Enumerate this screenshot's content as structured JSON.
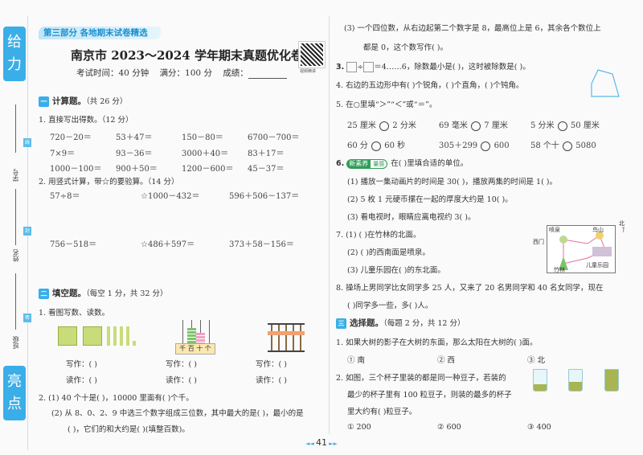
{
  "side": {
    "top_tab": "给力",
    "bottom_tab": "亮点",
    "student_id": "学号",
    "name": "姓名",
    "class": "班级",
    "marks": [
      "线",
      "封",
      "密"
    ]
  },
  "banner": "第三部分  各地期末试卷精选",
  "title": "南京市 2023～2024 学年期末真题优化卷(一)",
  "exam_info": {
    "time": "考试时间：40 分钟",
    "full": "满分：100 分",
    "score": "成绩："
  },
  "qr_label": "视频精讲",
  "section1": {
    "badge": "一",
    "title": "计算题。",
    "points": "（共 26 分）",
    "q1": {
      "label": "1. 直接写出得数。（12 分）",
      "items": [
        "720－20＝",
        "53＋47＝",
        "150－80＝",
        "6700－700＝",
        "7×9＝",
        "93－36＝",
        "3000＋40＝",
        "83＋17＝",
        "1000－100＝",
        "900＋50＝",
        "1200－600＝",
        "45－37＝"
      ]
    },
    "q2": {
      "label": "2. 用竖式计算，带☆的要验算。（14 分）",
      "items": [
        "57÷8＝",
        "☆1000－432＝",
        "596＋506－137＝",
        "756－518＝",
        "☆486＋597＝",
        "373＋58－156＝"
      ]
    }
  },
  "section2": {
    "badge": "二",
    "title": "填空题。",
    "points": "（每空 1 分，共 32 分）",
    "q1": "1. 看图写数、读数。",
    "abacus_label": "千 百 十 个",
    "write": "写作：(      )",
    "read": "读作：(          )",
    "q2_1": "2. (1) 40 个十是(      )，10000 里面有(      )个千。",
    "q2_2": "(2) 从 8、0、2、9 中选三个数字组成三位数，其中最大的是(      )，最小的是",
    "q2_2b": "(      )，它们的和大约是(      )(填整百数)。",
    "q2_3": "(3) 一个四位数，从右边起第二个数字是 8，最高位上是 6，其余各个数位上",
    "q2_3b": "都是 0，这个数写作(      )。",
    "q3_num": "3.",
    "q3_text": "÷",
    "q3_rest": "＝4……6，除数最小是(      )，这时被除数是(      )。",
    "q4": "4. 右边的五边形中有(      )个锐角，(      )个直角，(      )个钝角。",
    "q5": "5. 在○里填“＞”“＜”或“＝”。",
    "q5_items": [
      [
        "25 厘米",
        "2 分米"
      ],
      [
        "69 毫米",
        "7 厘米"
      ],
      [
        "5 分米",
        "50 厘米"
      ],
      [
        "60 分",
        "60 秒"
      ],
      [
        "305＋299",
        "600"
      ],
      [
        "58 个十",
        "5080"
      ]
    ],
    "q6_num": "6.",
    "q6_tag": "新素养",
    "q6_tag2": "量感",
    "q6": "在(      )里填合适的单位。",
    "q6_items": [
      "(1) 播放一集动画片的时间是 30(      )，播放两集的时间是 1(      )。",
      "(2) 5 枚 1 元硬币摞在一起的厚度大约是 10(      )。",
      "(3) 看电视时，眼睛应离电视约 3(      )。"
    ],
    "q7_items": [
      "7. (1) (      )在竹林的北面。",
      "(2) (      )的西南面是喷泉。",
      "(3) 儿童乐园在(      )的东北面。"
    ],
    "map": {
      "north": "北",
      "fountain": "喷泉",
      "bird_hill": "鸟山",
      "west_gate": "西门",
      "bamboo": "竹林",
      "playground": "儿童乐园"
    },
    "q8": "8. 操场上男同学比女同学多 25 人，又来了 20 名男同学和 40 名女同学，现在",
    "q8b": "(      )同学多一些，多(      )人。"
  },
  "section3": {
    "badge": "三",
    "title": "选择题。",
    "points": "（每题 2 分，共 12 分）",
    "q1": "1. 如果大树的影子在大树的东面，那么太阳在大树的(      )面。",
    "q1_opts": [
      "① 南",
      "② 西",
      "③ 北"
    ],
    "q2": [
      "2. 如图，三个杯子里装的都是同一种豆子，若装的",
      "最少的杯子里有 100 粒豆子，则装的最多的杯子",
      "里大约有(      )粒豆子。"
    ],
    "q2_opts": [
      "① 200",
      "② 600",
      "③ 400"
    ]
  },
  "page_number": "41"
}
